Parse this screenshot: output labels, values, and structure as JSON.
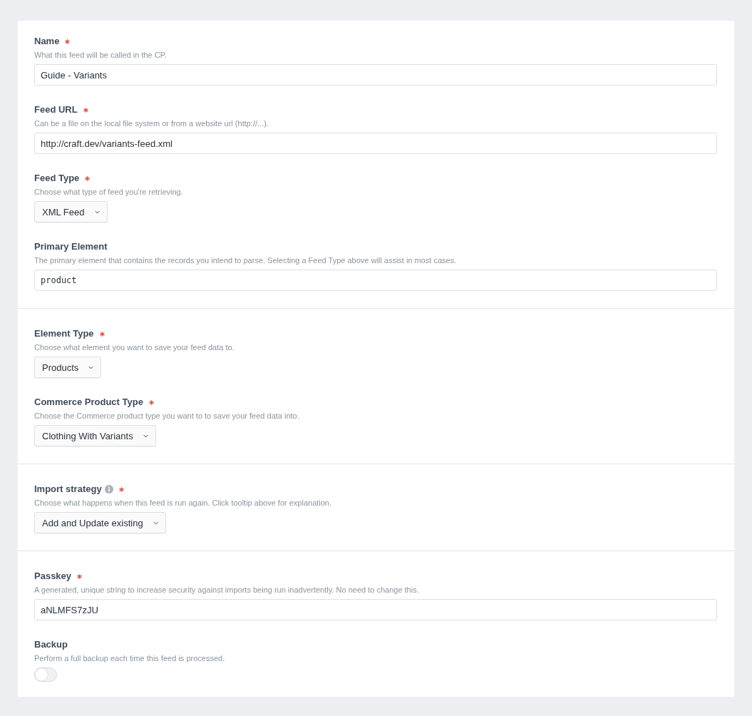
{
  "sections": [
    {
      "fields": [
        {
          "kind": "text",
          "label": "Name",
          "required": true,
          "info": false,
          "instructions": "What this feed will be called in the CP.",
          "value": "Guide - Variants"
        },
        {
          "kind": "text",
          "label": "Feed URL",
          "required": true,
          "info": false,
          "instructions": "Can be a file on the local file system or from a website url (http://...).",
          "value": "http://craft.dev/variants-feed.xml"
        },
        {
          "kind": "select",
          "label": "Feed Type",
          "required": true,
          "info": false,
          "instructions": "Choose what type of feed you're retrieving.",
          "value": "XML Feed"
        },
        {
          "kind": "code",
          "label": "Primary Element",
          "required": false,
          "info": false,
          "instructions": "The primary element that contains the records you intend to parse. Selecting a Feed Type above will assist in most cases.",
          "value": "product"
        }
      ]
    },
    {
      "fields": [
        {
          "kind": "select",
          "label": "Element Type",
          "required": true,
          "info": false,
          "instructions": "Choose what element you want to save your feed data to.",
          "value": "Products"
        },
        {
          "kind": "select",
          "label": "Commerce Product Type",
          "required": true,
          "info": false,
          "instructions": "Choose the Commerce product type you want to to save your feed data into.",
          "value": "Clothing With Variants"
        }
      ]
    },
    {
      "fields": [
        {
          "kind": "select",
          "label": "Import strategy",
          "required": true,
          "info": true,
          "instructions": "Choose what happens when this feed is run again. Click tooltip above for explanation.",
          "value": "Add and Update existing"
        }
      ]
    },
    {
      "fields": [
        {
          "kind": "text",
          "label": "Passkey",
          "required": true,
          "info": false,
          "instructions": "A generated, unique string to increase security against imports being run inadvertently. No need to change this.",
          "value": "aNLMFS7zJU"
        },
        {
          "kind": "toggle",
          "label": "Backup",
          "required": false,
          "info": false,
          "instructions": "Perform a full backup each time this feed is processed.",
          "on": false
        }
      ]
    }
  ]
}
